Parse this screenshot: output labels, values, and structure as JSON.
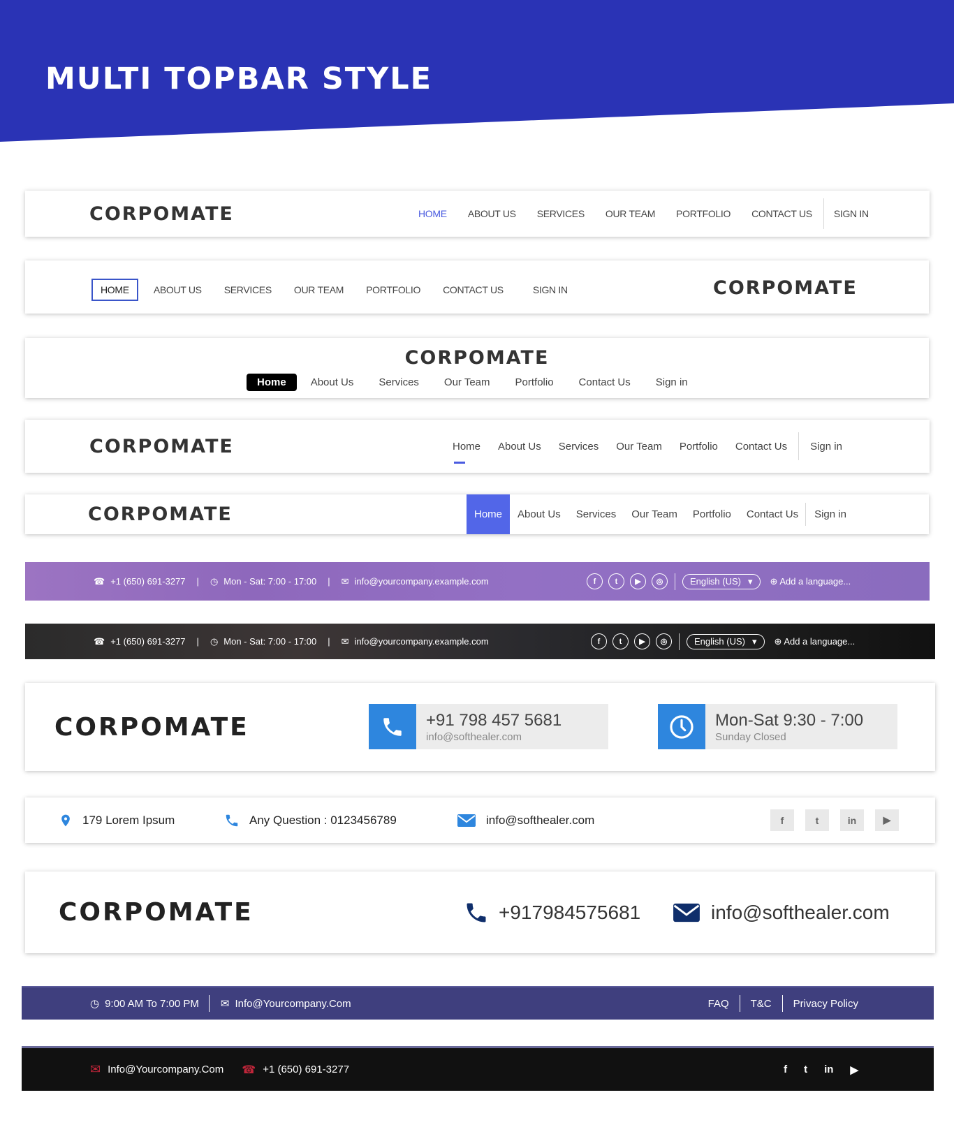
{
  "hero": {
    "title": "MULTI TOPBAR STYLE",
    "color": "#2a33b5"
  },
  "logo": "CORPOMATE",
  "bar1": {
    "nav": [
      "HOME",
      "ABOUT US",
      "SERVICES",
      "OUR TEAM",
      "PORTFOLIO",
      "CONTACT US"
    ],
    "signin": "SIGN IN"
  },
  "bar2": {
    "nav": [
      "HOME",
      "ABOUT US",
      "SERVICES",
      "OUR TEAM",
      "PORTFOLIO",
      "CONTACT US",
      "SIGN IN"
    ]
  },
  "bar3": {
    "nav": [
      "Home",
      "About Us",
      "Services",
      "Our Team",
      "Portfolio",
      "Contact Us",
      "Sign in"
    ]
  },
  "bar4": {
    "nav": [
      "Home",
      "About Us",
      "Services",
      "Our Team",
      "Portfolio",
      "Contact Us"
    ],
    "signin": "Sign in"
  },
  "bar5": {
    "nav": [
      "Home",
      "About Us",
      "Services",
      "Our Team",
      "Portfolio",
      "Contact Us"
    ],
    "signin": "Sign in"
  },
  "info_bar": {
    "phone": "+1 (650) 691-3277",
    "hours": "Mon - Sat: 7:00 - 17:00",
    "email": "info@yourcompany.example.com",
    "language": "English (US)",
    "add_language": "Add a language...",
    "social": [
      "facebook-icon",
      "twitter-icon",
      "youtube-icon",
      "instagram-icon"
    ]
  },
  "bar8": {
    "phone": "+91 798 457 5681",
    "email": "info@softhealer.com",
    "hours": "Mon-Sat 9:30 - 7:00",
    "closed": "Sunday Closed"
  },
  "bar9": {
    "address": "179 Lorem Ipsum",
    "question": "Any Question : 0123456789",
    "email": "info@softhealer.com",
    "social": [
      "f",
      "t",
      "in",
      "yt"
    ]
  },
  "bar10": {
    "phone": "+917984575681",
    "email": "info@softhealer.com"
  },
  "bar11": {
    "hours": "9:00 AM To 7:00 PM",
    "email": "Info@Yourcompany.Com",
    "links": [
      "FAQ",
      "T&C",
      "Privacy Policy"
    ]
  },
  "bar12": {
    "email": "Info@Yourcompany.Com",
    "phone": "+1 (650) 691-3277",
    "social": [
      "facebook-icon",
      "twitter-icon",
      "linkedin-icon",
      "youtube-icon"
    ]
  }
}
